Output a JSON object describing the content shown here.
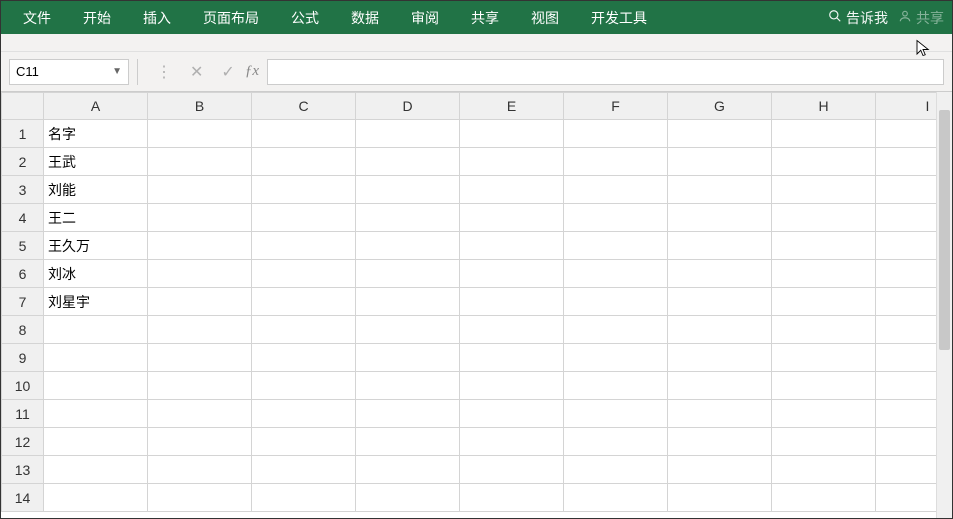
{
  "ribbon": {
    "tabs": [
      "文件",
      "开始",
      "插入",
      "页面布局",
      "公式",
      "数据",
      "审阅",
      "共享",
      "视图",
      "开发工具"
    ],
    "tell_me": "告诉我",
    "share": "共享"
  },
  "formula_bar": {
    "name_box": "C11",
    "formula": ""
  },
  "grid": {
    "columns": [
      "A",
      "B",
      "C",
      "D",
      "E",
      "F",
      "G",
      "H",
      "I"
    ],
    "rows": 14,
    "cells": {
      "A1": "名字",
      "A2": "王武",
      "A3": "刘能",
      "A4": "王二",
      "A5": "王久万",
      "A6": "刘冰",
      "A7": "刘星宇"
    }
  }
}
